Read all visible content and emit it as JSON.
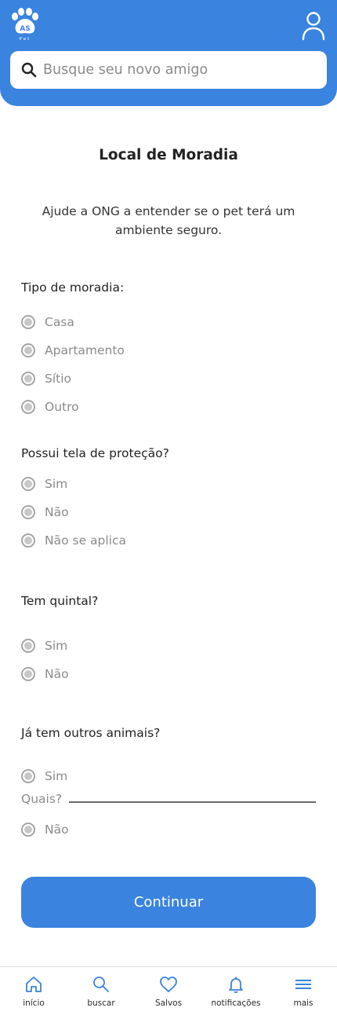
{
  "header": {
    "logo_text": "AS Pet",
    "search_placeholder": "Busque seu novo amigo",
    "brand_color": "#3a83df"
  },
  "page": {
    "title": "Local de Moradia",
    "subtitle": "Ajude a ONG a entender se o pet terá um ambiente seguro."
  },
  "questions": {
    "moradia": {
      "label": "Tipo de moradia:",
      "options": [
        "Casa",
        "Apartamento",
        "Sítio",
        "Outro"
      ]
    },
    "tela": {
      "label": "Possui tela de proteção?",
      "options": [
        "Sim",
        "Não",
        "Não se aplica"
      ]
    },
    "quintal": {
      "label": "Tem quintal?",
      "options": [
        "Sim",
        "Não"
      ]
    },
    "animais": {
      "label": "Já tem outros animais?",
      "options": [
        "Sim",
        "Não"
      ],
      "quais_label": "Quais?"
    }
  },
  "actions": {
    "continue_label": "Continuar"
  },
  "nav": {
    "items": [
      {
        "label": "início",
        "icon": "home-icon"
      },
      {
        "label": "buscar",
        "icon": "search-icon"
      },
      {
        "label": "Salvos",
        "icon": "heart-icon"
      },
      {
        "label": "notificações",
        "icon": "bell-icon"
      },
      {
        "label": "mais",
        "icon": "menu-icon"
      }
    ]
  }
}
